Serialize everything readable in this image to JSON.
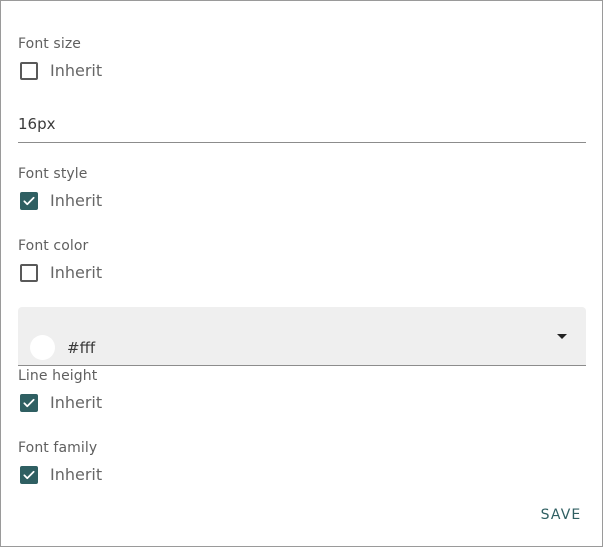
{
  "settings": {
    "font_size": {
      "label": "Font size",
      "inherit_label": "Inherit",
      "inherit_checked": false,
      "value": "16px"
    },
    "font_style": {
      "label": "Font style",
      "inherit_label": "Inherit",
      "inherit_checked": true
    },
    "font_color": {
      "label": "Font color",
      "inherit_label": "Inherit",
      "inherit_checked": false,
      "value": "#fff",
      "swatch_color": "#ffffff"
    },
    "line_height": {
      "label": "Line height",
      "inherit_label": "Inherit",
      "inherit_checked": true
    },
    "font_family": {
      "label": "Font family",
      "inherit_label": "Inherit",
      "inherit_checked": true
    }
  },
  "actions": {
    "save_label": "SAVE"
  },
  "colors": {
    "accent": "#2f5f62",
    "field_background": "#efefef",
    "border": "#9a9a9a"
  },
  "icons": {
    "checkbox": "check-icon",
    "dropdown": "dropdown-arrow-icon"
  }
}
